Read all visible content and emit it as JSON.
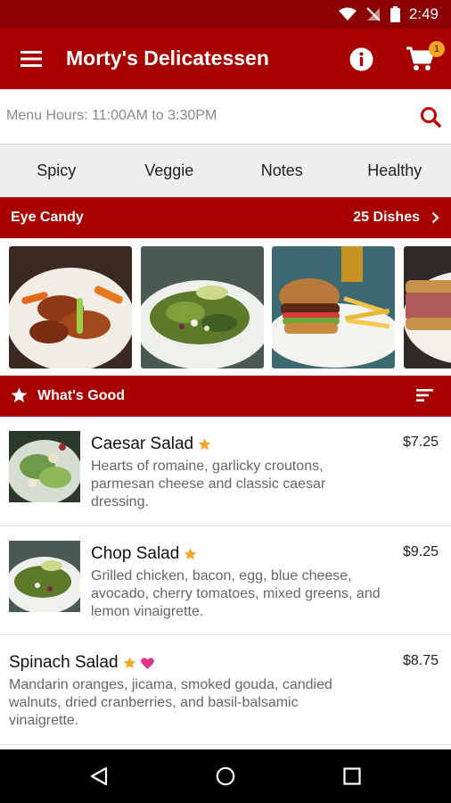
{
  "status_bar": {
    "time": "2:49"
  },
  "app_bar": {
    "title": "Morty's Delicatessen",
    "cart_count": "1"
  },
  "search": {
    "text": "Menu Hours: 11:00AM to 3:30PM"
  },
  "filters": [
    "Spicy",
    "Veggie",
    "Notes",
    "Healthy"
  ],
  "eye_candy": {
    "title": "Eye Candy",
    "count_label": "25 Dishes"
  },
  "whats_good": {
    "title": "What's Good"
  },
  "menu_items": [
    {
      "name": "Caesar Salad",
      "price": "$7.25",
      "description": "Hearts of romaine, garlicky croutons, parmesan cheese and classic caesar dressing.",
      "badges": [
        "star"
      ]
    },
    {
      "name": "Chop Salad",
      "price": "$9.25",
      "description": "Grilled chicken, bacon, egg, blue cheese, avocado, cherry tomatoes, mixed greens, and lemon vinaigrette.",
      "badges": [
        "star"
      ]
    },
    {
      "name": "Spinach Salad",
      "price": "$8.75",
      "description": "Mandarin oranges, jicama, smoked gouda, candied walnuts, dried cranberries, and basil-balsamic vinaigrette.",
      "badges": [
        "star",
        "heart"
      ]
    }
  ],
  "colors": {
    "brand_red": "#a80000",
    "status_red": "#8b0000",
    "star": "#f5a623",
    "heart": "#e0338c"
  }
}
